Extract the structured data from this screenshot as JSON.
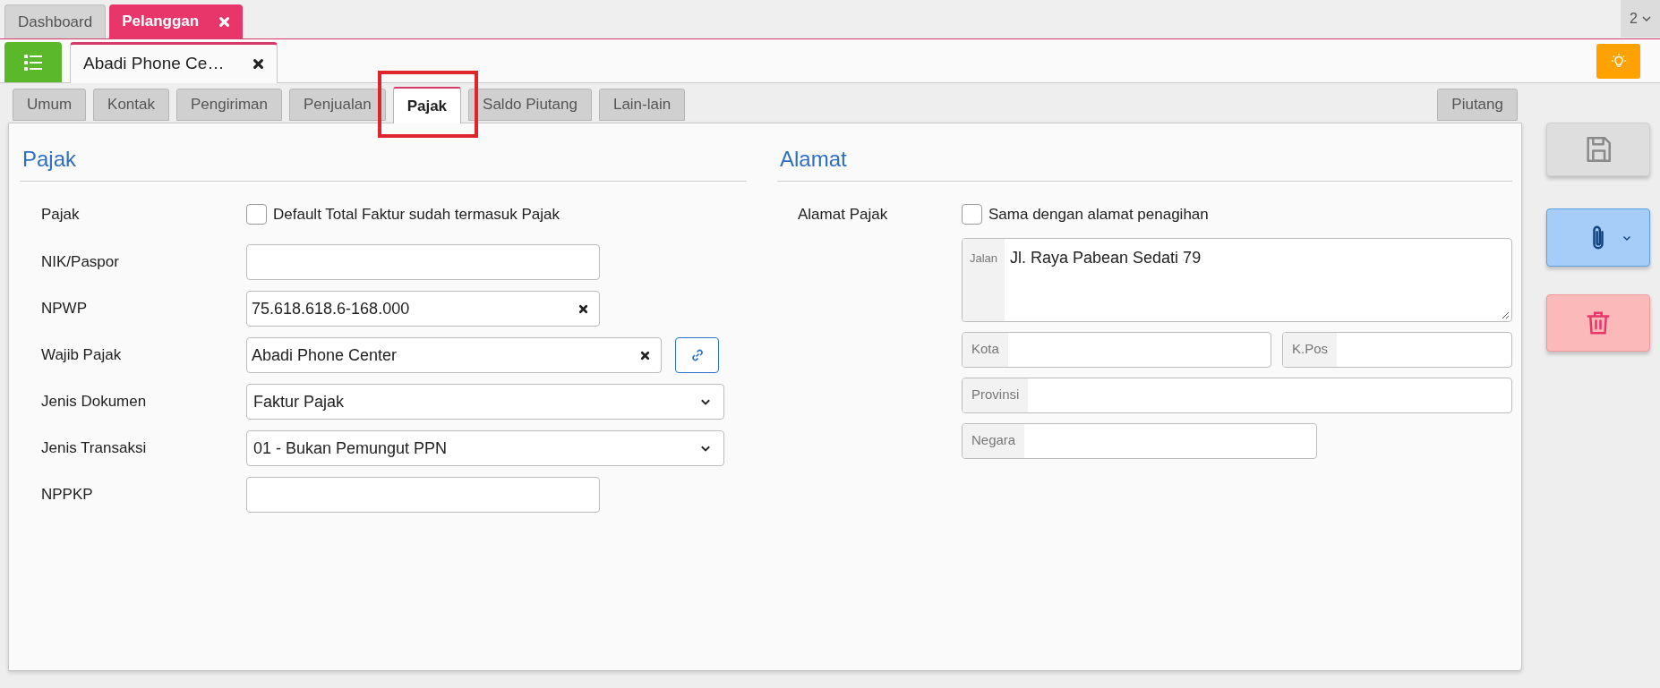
{
  "app_tabs": [
    {
      "label": "Dashboard",
      "selected": false,
      "closable": false
    },
    {
      "label": "Pelanggan",
      "selected": true,
      "closable": true
    }
  ],
  "tab_overflow": {
    "count": "2"
  },
  "document_tab": {
    "title": "Abadi Phone Ce…",
    "closable": true
  },
  "form_tabs": [
    {
      "label": "Umum",
      "selected": false
    },
    {
      "label": "Kontak",
      "selected": false
    },
    {
      "label": "Pengiriman",
      "selected": false
    },
    {
      "label": "Penjualan",
      "selected": false
    },
    {
      "label": "Pajak",
      "selected": true
    },
    {
      "label": "Saldo Piutang",
      "selected": false
    },
    {
      "label": "Lain-lain",
      "selected": false
    }
  ],
  "side_tab": {
    "label": "Piutang",
    "selected": false
  },
  "tax_section": {
    "title": "Pajak",
    "fields": [
      {
        "kind": "checkbox",
        "label": "Pajak",
        "text": "Default Total Faktur sudah termasuk Pajak",
        "checked": false
      },
      {
        "kind": "text",
        "label": "NIK/Paspor"
      },
      {
        "kind": "clearable",
        "label": "NPWP",
        "value": "75.618.618.6-168.000"
      },
      {
        "kind": "clearable_link",
        "label": "Wajib Pajak",
        "value": "Abadi Phone Center"
      },
      {
        "kind": "select",
        "label": "Jenis Dokumen",
        "value": "Faktur Pajak"
      },
      {
        "kind": "select",
        "label": "Jenis Transaksi",
        "value": "01 - Bukan Pemungut PPN"
      },
      {
        "kind": "text",
        "label": "NPPKP"
      }
    ]
  },
  "address_section": {
    "title": "Alamat",
    "label": "Alamat Pajak",
    "same_as_billing": {
      "text": "Sama dengan alamat penagihan",
      "checked": false
    },
    "street": {
      "addon": "Jalan",
      "value": "Jl. Raya Pabean Sedati 79"
    },
    "city": {
      "addon": "Kota"
    },
    "postal_code": {
      "addon": "K.Pos"
    },
    "province": {
      "addon": "Provinsi"
    },
    "country": {
      "addon": "Negara"
    }
  },
  "save_button": {
    "disabled": true
  }
}
